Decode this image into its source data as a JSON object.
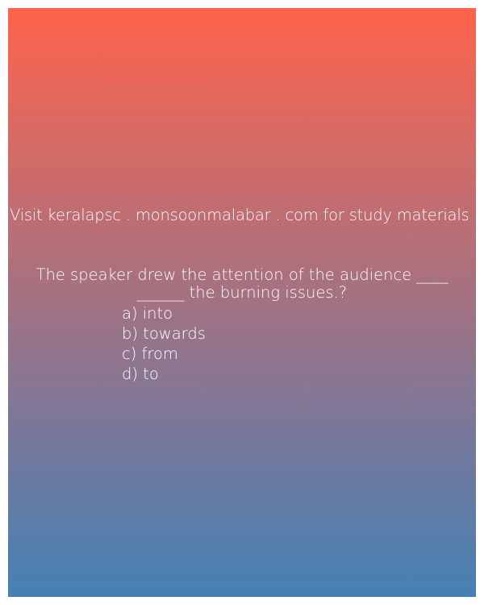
{
  "promo": {
    "text": "Visit keralapsc . monsoonmalabar . com for study materials"
  },
  "question": {
    "line1": "The speaker drew the attention of the audience ____",
    "line2": "______ the burning issues.?"
  },
  "options": [
    {
      "label": "a) into"
    },
    {
      "label": "b) towards"
    },
    {
      "label": "c) from"
    },
    {
      "label": "d) to"
    }
  ],
  "colors": {
    "gradient_top": "#ff634c",
    "gradient_bottom": "#4680b4",
    "text": "#ffffff"
  }
}
